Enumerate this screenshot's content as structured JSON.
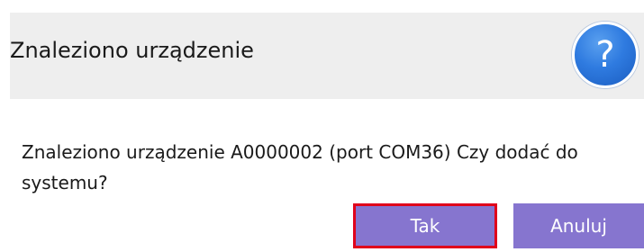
{
  "dialog": {
    "title": "Znaleziono urządzenie",
    "help_icon": "question-mark-icon",
    "help_symbol": "?",
    "message": "Znaleziono urządzenie A0000002 (port COM36) Czy dodać do systemu?",
    "buttons": {
      "yes_label": "Tak",
      "cancel_label": "Anuluj"
    },
    "colors": {
      "header_bg": "#eeeeee",
      "button_bg": "#8675cf",
      "highlight_border": "#e0001b",
      "icon_blue": "#2f7be0"
    }
  }
}
